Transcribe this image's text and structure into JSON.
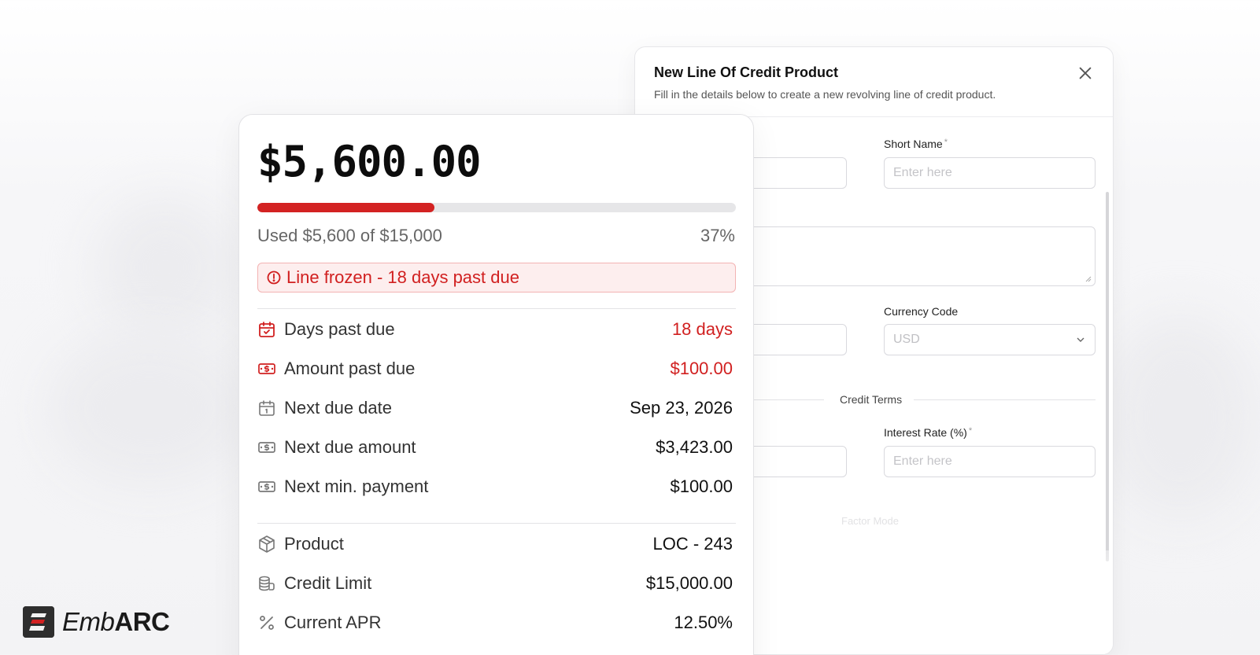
{
  "modal": {
    "title": "New Line Of Credit Product",
    "subtitle": "Fill in the details below to create a new revolving line of credit product.",
    "fields": {
      "short_name_label": "Short Name",
      "short_name_placeholder": "Enter here",
      "currency_code_label": "Currency Code",
      "currency_code_value": "USD",
      "interest_rate_label": "Interest Rate (%)",
      "interest_rate_placeholder": "Enter here",
      "required_mark": "*"
    },
    "sections": {
      "credit_terms": "Credit Terms",
      "factor_mode": "Factor Mode"
    }
  },
  "card": {
    "balance": "$5,600.00",
    "usage": {
      "text": "Used $5,600 of $15,000",
      "percent_label": "37%",
      "fraction": 0.37
    },
    "alert": "Line frozen - 18 days past due",
    "rows": [
      {
        "icon": "calendar-check-icon",
        "label": "Days past due",
        "value": "18 days",
        "alert": true
      },
      {
        "icon": "cash-icon",
        "label": "Amount past due",
        "value": "$100.00",
        "alert": true
      },
      {
        "icon": "calendar-icon",
        "label": "Next due date",
        "value": "Sep 23, 2026",
        "alert": false
      },
      {
        "icon": "cash-icon",
        "label": "Next due amount",
        "value": "$3,423.00",
        "alert": false
      },
      {
        "icon": "cash-icon",
        "label": "Next min. payment",
        "value": "$100.00",
        "alert": false
      },
      {
        "icon": "box-icon",
        "label": "Product",
        "value": "LOC - 243",
        "alert": false
      },
      {
        "icon": "coins-icon",
        "label": "Credit Limit",
        "value": "$15,000.00",
        "alert": false
      },
      {
        "icon": "percent-icon",
        "label": "Current APR",
        "value": "12.50%",
        "alert": false
      }
    ]
  },
  "brand": {
    "name_light": "Emb",
    "name_bold": "ARC"
  },
  "colors": {
    "alert_red": "#d12020",
    "progress_red": "#d32222"
  }
}
